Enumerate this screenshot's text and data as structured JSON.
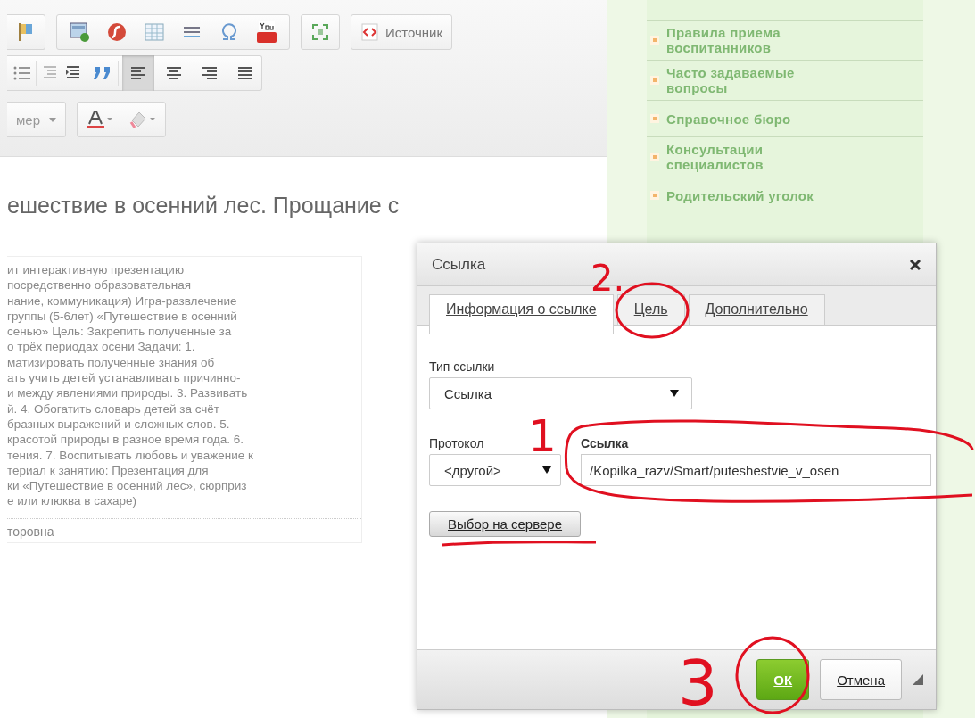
{
  "editor": {
    "toolbar": {
      "source_button": "Источник",
      "size_dropdown": "мер",
      "align_buttons": [
        {
          "selected": true
        },
        {
          "selected": false
        },
        {
          "selected": false
        },
        {
          "selected": false
        }
      ]
    },
    "heading": "ешествие в осенний лес. Прощание с",
    "content_lines": [
      "ит интерактивную презентацию",
      "посредственно образовательная",
      "нание, коммуникация) Игра-развлечение",
      "группы (5-6лет) «Путешествие в осенний",
      "сенью» Цель: Закрепить полученные за",
      "о трёх периодах осени Задачи: 1.",
      "матизировать полученные знания об",
      "ать учить детей устанавливать причинно-",
      "и между явлениями природы. 3. Развивать",
      "й. 4. Обогатить словарь детей за счёт",
      "бразных выражений и сложных слов. 5.",
      "красотой природы в разное время года. 6.",
      "тения. 7. Воспитывать любовь и уважение к",
      "териал к занятию: Презентация для",
      "ки «Путешествие в осенний лес», сюрприз",
      "е или клюква в сахаре)"
    ],
    "footer_text": "торовна"
  },
  "sidebar": {
    "items": [
      "Правила приема воспитанников",
      "Часто задаваемые вопросы",
      "Справочное бюро",
      "Консультации специалистов",
      "Родительский уголок"
    ]
  },
  "dialog": {
    "title": "Ссылка",
    "tabs": [
      {
        "label": "Информация о ссылке",
        "selected": true
      },
      {
        "label": "Цель",
        "selected": false
      },
      {
        "label": "Дополнительно",
        "selected": false
      }
    ],
    "link_type": {
      "label": "Тип ссылки",
      "value": "Ссылка"
    },
    "protocol": {
      "label": "Протокол",
      "value": "<другой>"
    },
    "url": {
      "label": "Ссылка",
      "value": "/Kopilka_razv/Smart/puteshestvie_v_osen"
    },
    "browse_button": "Выбор на сервере",
    "buttons": [
      {
        "label": "ОК",
        "kind": "primary"
      },
      {
        "label": "Отмена",
        "kind": "secondary"
      }
    ]
  },
  "annotations": [
    "2.",
    "1",
    "3"
  ]
}
